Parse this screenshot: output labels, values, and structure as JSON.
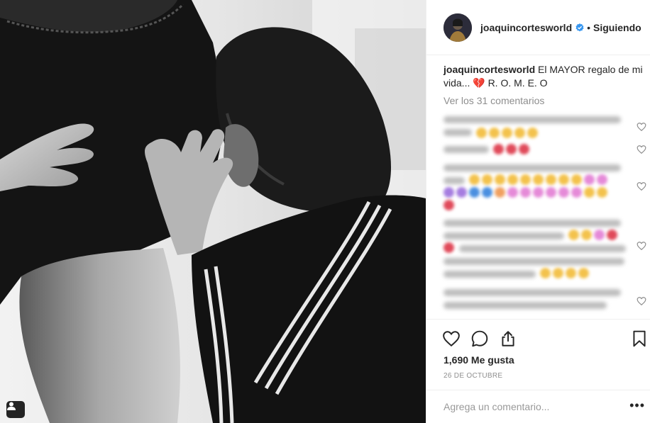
{
  "post": {
    "username": "joaquincortesworld",
    "follow_status": "Siguiendo",
    "separator": "•",
    "caption_user": "joaquincortesworld",
    "caption_text": "El MAYOR regalo de mi vida... 💔 R. O. M. E. O",
    "view_comments": "Ver los 31 comentarios",
    "likes": "1,690 Me gusta",
    "date": "26 DE OCTUBRE",
    "add_comment_placeholder": "Agrega un comentario...",
    "more_options": "•••"
  },
  "icons": {
    "like": "heart-outline-icon",
    "comment": "speech-bubble-icon",
    "share": "share-upload-icon",
    "save": "bookmark-icon",
    "verified": "verified-badge-icon",
    "tag": "user-tag-icon"
  },
  "colors": {
    "verified_blue": "#3897f0",
    "text": "#262626",
    "muted": "#8e8e8e",
    "border": "#efefef"
  }
}
